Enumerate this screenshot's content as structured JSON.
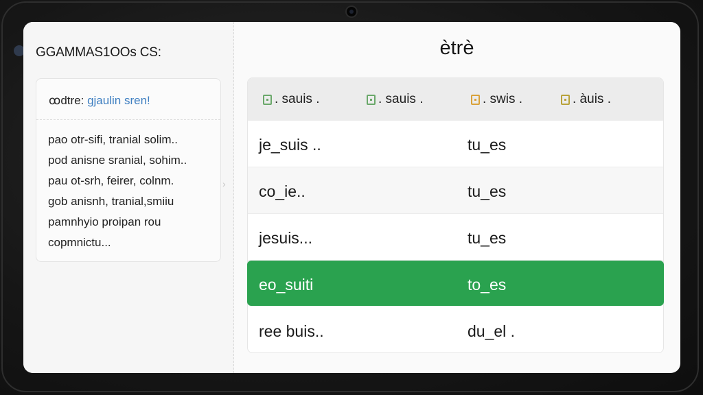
{
  "colors": {
    "accent_green": "#2aa24f",
    "highlight_blue": "#3f7fc1",
    "icon_green": "#6aa86a",
    "icon_orange": "#d9a23a",
    "icon_olive": "#b8a23a"
  },
  "sidebar": {
    "title": "GGAMMAS1OOs CS:",
    "card": {
      "label_prefix": "ꝏdtre:",
      "label_highlight": "gjaulin sren!",
      "lines": [
        "pao otr-sifi, tranial  solim..",
        "pod anisne sranial, sohim..",
        "pau ot-srh, feirer, colnm.",
        "gob anisnh, tranial,smiiu",
        "pamnhyio proipan rou",
        "copmnictu..."
      ]
    }
  },
  "main": {
    "title": "ètrè",
    "columns": [
      {
        "icon": "document-icon",
        "label": ". sauis ."
      },
      {
        "icon": "document-icon",
        "label": ". sauis ."
      },
      {
        "icon": "document-icon",
        "label": ". swis ."
      },
      {
        "icon": "document-icon",
        "label": ". àuis ."
      }
    ],
    "rows": [
      {
        "left": "je_suis ..",
        "right": "tu_es",
        "selected": false
      },
      {
        "left": "co_ie..",
        "right": "tu_es",
        "selected": false
      },
      {
        "left": "jesuis...",
        "right": "tu_es",
        "selected": false
      },
      {
        "left": "eo_suiti",
        "right": "to_es",
        "selected": true
      },
      {
        "left": "ree buis..",
        "right": "du_el .",
        "selected": false
      }
    ]
  }
}
